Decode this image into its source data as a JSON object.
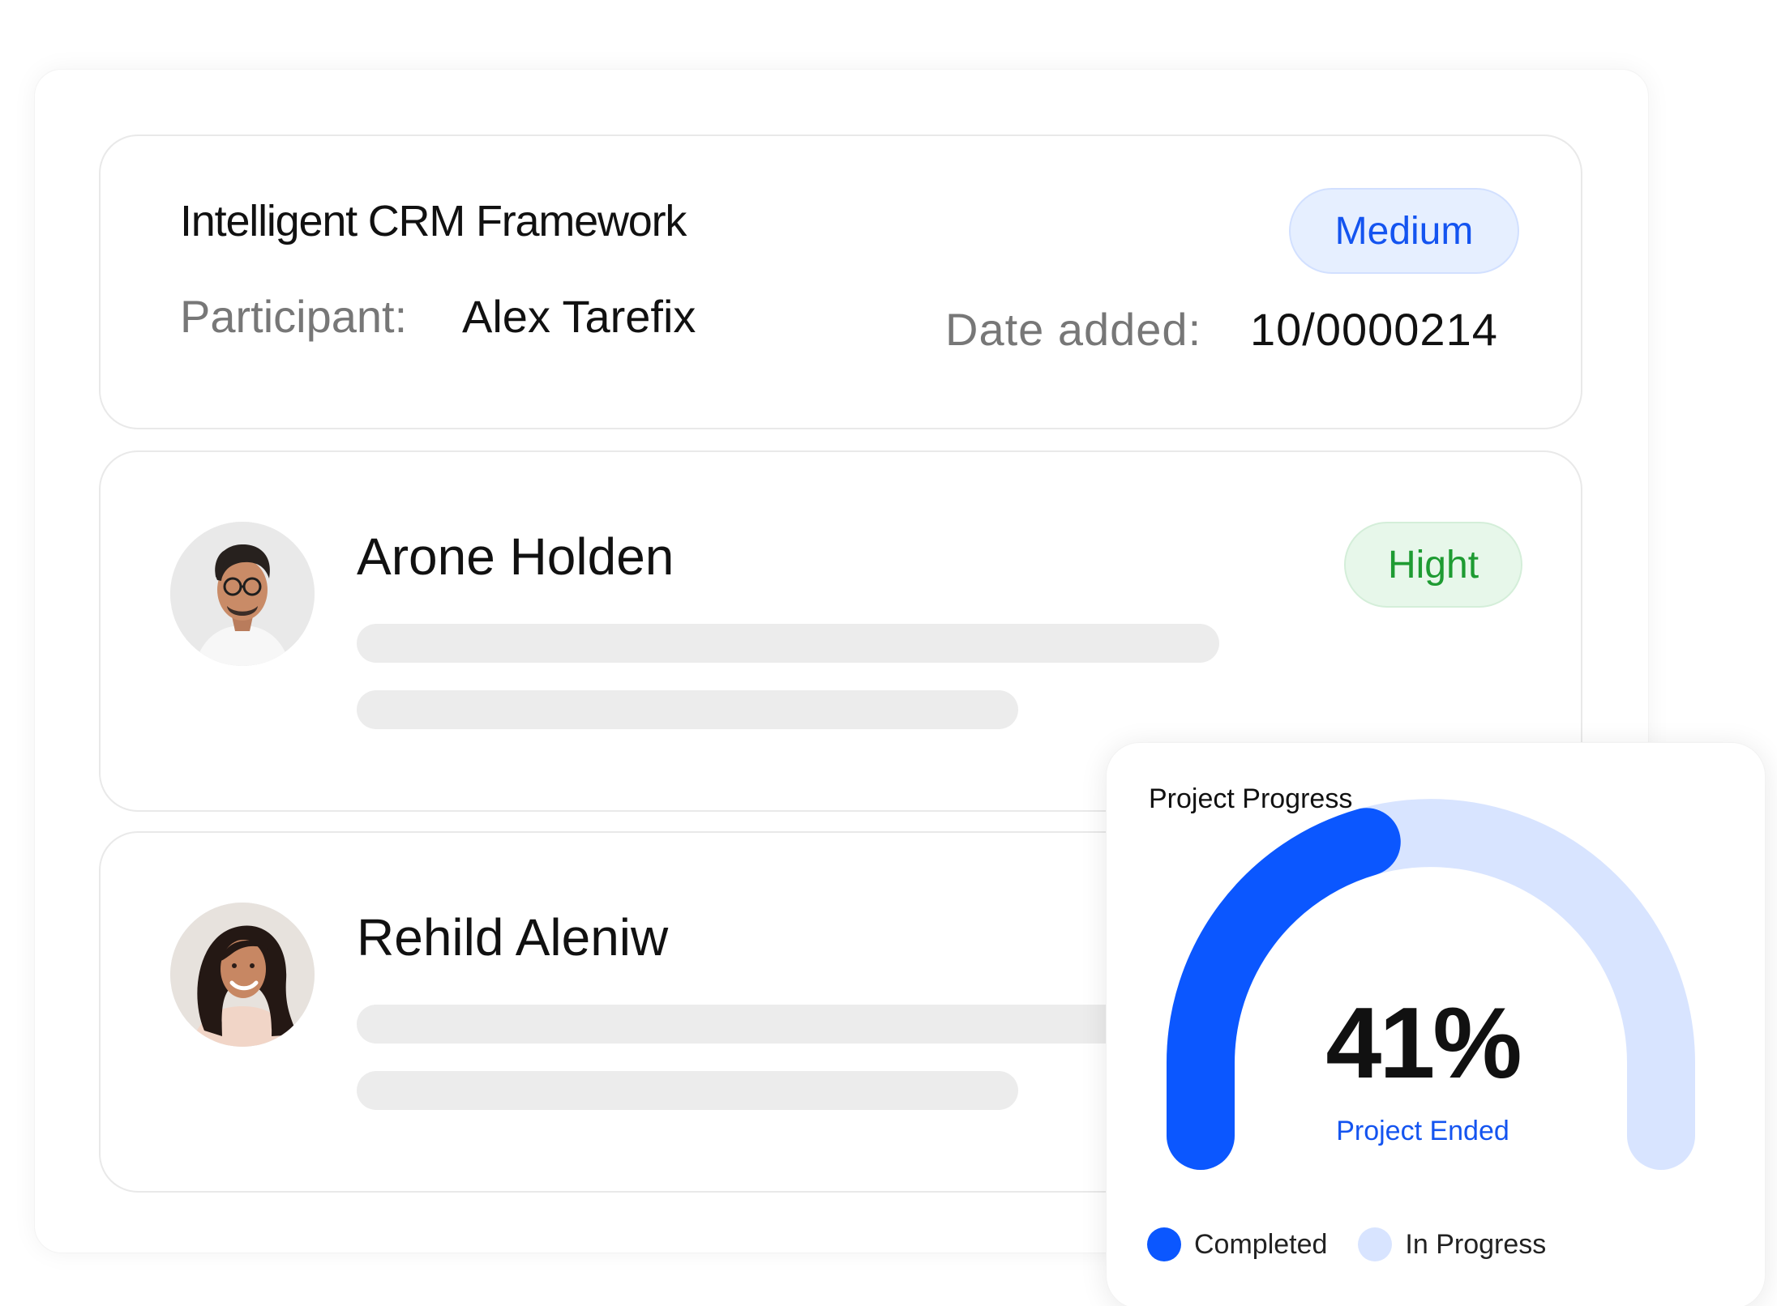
{
  "project": {
    "title": "Intelligent CRM Framework",
    "participant_label": "Participant:",
    "participant_name": "Alex Tarefix",
    "date_label": "Date added:",
    "date_value": "10/0000214",
    "priority": "Medium"
  },
  "people": [
    {
      "name": "Arone Holden",
      "priority": "Hight"
    },
    {
      "name": "Rehild Aleniw"
    }
  ],
  "progress": {
    "title": "Project Progress",
    "percent_label": "41%",
    "completed_fraction": 0.41,
    "status": "Project Ended",
    "legend": [
      {
        "label": "Completed",
        "color": "#0b57ff"
      },
      {
        "label": "In Progress",
        "color": "#d8e4ff"
      }
    ]
  },
  "colors": {
    "accent_blue": "#0b57ff",
    "light_blue": "#d8e4ff",
    "high_green": "#1e9b32"
  }
}
